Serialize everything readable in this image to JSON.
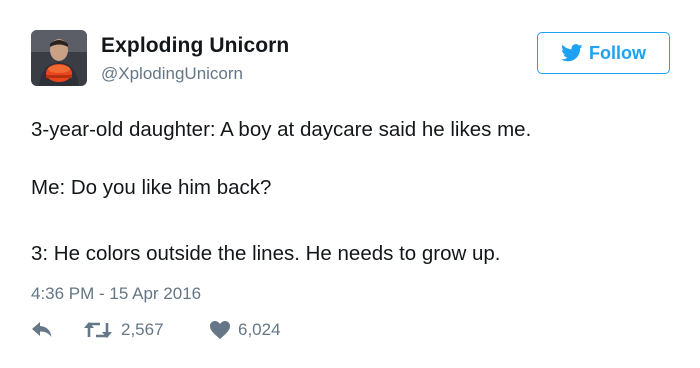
{
  "user": {
    "display_name": "Exploding Unicorn",
    "handle": "@XplodingUnicorn"
  },
  "follow_button": {
    "label": "Follow"
  },
  "tweet": {
    "lines": [
      "3-year-old daughter: A boy at daycare said he likes me.",
      "Me: Do you like him back?",
      "3: He colors outside the lines. He needs to grow up."
    ],
    "timestamp": "4:36 PM - 15 Apr 2016"
  },
  "actions": {
    "retweets": "2,567",
    "likes": "6,024"
  },
  "colors": {
    "accent": "#1da1f2",
    "secondary_text": "#657786",
    "primary_text": "#14171a"
  },
  "icons": [
    "twitter-bird-icon",
    "reply-icon",
    "retweet-icon",
    "heart-icon"
  ]
}
